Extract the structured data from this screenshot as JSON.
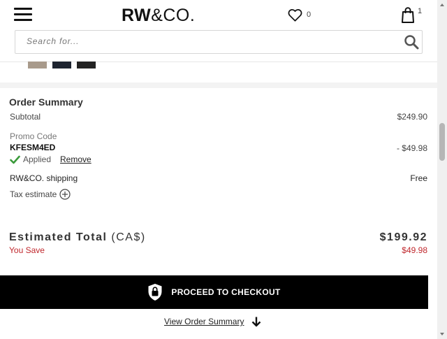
{
  "header": {
    "logo_bold": "RW",
    "logo_rest": "&CO.",
    "wishlist_count": "0",
    "bag_count": "1"
  },
  "search": {
    "placeholder": "Search for..."
  },
  "swatches": [
    "#a89a8b",
    "#1e2430",
    "#222222"
  ],
  "order_summary": {
    "title": "Order Summary",
    "subtotal_label": "Subtotal",
    "subtotal_value": "$249.90",
    "promo_label": "Promo Code",
    "promo_code": "KFESM4ED",
    "promo_discount": "- $49.98",
    "applied_label": "Applied",
    "remove_label": "Remove",
    "shipping_label": "RW&CO. shipping",
    "shipping_value": "Free",
    "tax_label": "Tax estimate"
  },
  "total": {
    "label": "Estimated Total",
    "currency": "(CA$)",
    "value": "$199.92",
    "you_save_label": "You Save",
    "you_save_value": "$49.98"
  },
  "checkout": {
    "button_label": "PROCEED TO CHECKOUT"
  },
  "view_summary": {
    "label": "View Order Summary"
  },
  "colors": {
    "accent_red": "#c0282d",
    "check_green": "#3a9a3a",
    "checkout_bg": "#000000"
  }
}
